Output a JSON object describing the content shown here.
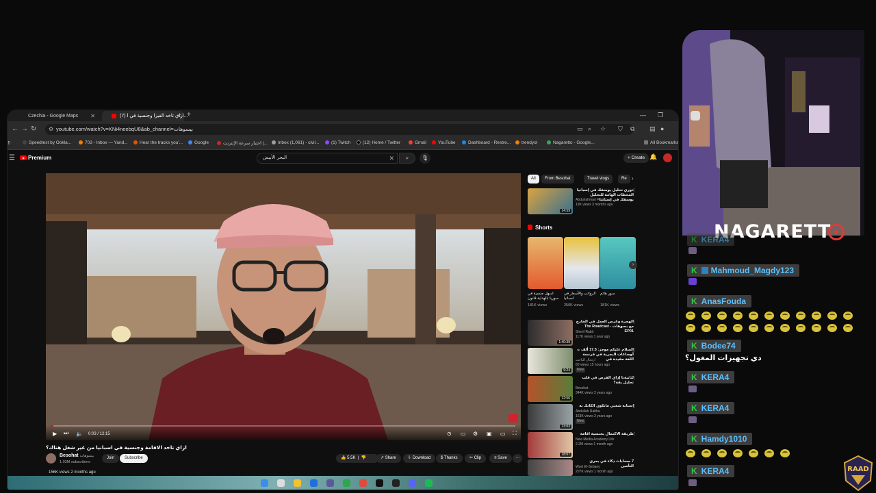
{
  "browser": {
    "tabs": [
      {
        "label": "Czechia - Google Maps",
        "active": false
      },
      {
        "label": "(7) ازاي تاخد الفيزا وجنسية في ا...",
        "active": true
      }
    ],
    "url": "youtube.com/watch?v=KNi4neebqU8&ab_channel=بيسوهات",
    "bookmarks": [
      "Speedtest by Ookla...",
      "703 - Inbox — Yand...",
      "Hear the tracks you'...",
      "Google",
      "اختبار سرعة الإنترنت |...",
      "Inbox (1,061) - civil...",
      "(1) Twitch",
      "(12) Home / Twitter",
      "Gmail",
      "YouTube",
      "Dashboard - Restre...",
      "trendyol",
      "Nagaretto - Google...",
      "All Bookmarks"
    ]
  },
  "youtube": {
    "logo": "Premium",
    "search_value": "البحر الأبيض",
    "create_label": "Create",
    "video": {
      "title": "ازاي تاخد الاقامة وجنسية في اسبانيا من غير شغل هناك؟",
      "time": "0:03 / 12:15",
      "progress": 0.004,
      "channel": "Besohat",
      "channel_ar": "بيسوهات",
      "subscribers": "1.03M subscribers",
      "join": "Join",
      "subscribe": "Subscribe",
      "likes": "5.5K",
      "share": "Share",
      "download": "Download",
      "thanks": "Thanks",
      "clip": "Clip",
      "save": "Save",
      "views_line": "156K views  2 months ago"
    },
    "chips": [
      "All",
      "From Besohat",
      "Travel vlogs",
      "Re"
    ],
    "top_rec": {
      "title": "دوري تحليل يوسفك في إسبانيا المحطات الهامة للتحليل بوسفك في إسبانيا",
      "channel": "Abdulrahman Fawzy",
      "meta": "19K views  3 months ago",
      "duration": "14:59"
    },
    "shorts_label": "Shorts",
    "shorts": [
      {
        "title": "اسهل جنسية في سوريا بالهداية قانون",
        "views": "181K views"
      },
      {
        "title": "الرواتب والأسعار في اسبانيا",
        "views": "250K views"
      },
      {
        "title": "سور هاتم",
        "views": "181K views"
      }
    ],
    "recs": [
      {
        "title": "الهجرة وغرص العمل في الخارج مع بسوهات - The Roadcast EP01",
        "channel": "Sherif Rabit",
        "meta": "117K views  1 year ago",
        "duration": "1:40:39"
      },
      {
        "title": "السلام عليكم موجز: 17.5 ألف ☕ أوضاعات البحرية في فرنسة اللغة مفيدة في",
        "channel": "ارتحال الباحث",
        "meta": "60 views  15 hours ago",
        "badge": "New",
        "duration": "9:24"
      },
      {
        "title": "لثانيةنا إزاي الفرص في قلب تحليل بقة؟",
        "channel": "Besohat",
        "meta": "344K views  2 years ago",
        "duration": "12:56"
      },
      {
        "title": "|سنانه شعبي مانكون الكانك ته",
        "channel": "Abdullah Rabha",
        "meta": "163K views  3 years ago",
        "badge": "New",
        "duration": "13:03"
      },
      {
        "title": "طريقة الاكتمال بجنسية اقامة",
        "channel": "New Media Academy Life",
        "meta": "2.2M views  1 month ago",
        "duration": "18:07"
      },
      {
        "title": "7 حسابات ذكاء في بمري التأمين",
        "channel": "Wael El-Sebaey",
        "meta": "207K views  1 month ago",
        "duration": ""
      }
    ]
  },
  "stream": {
    "streamer": "NAGARETT",
    "chat": [
      {
        "user": "KERA4",
        "emotes": 0,
        "message": ""
      },
      {
        "user": "Mahmoud_Magdy123",
        "emotes": 0,
        "message": ""
      },
      {
        "user": "AnasFouda",
        "emotes": 22,
        "message": ""
      },
      {
        "user": "Bodee74",
        "emotes": 0,
        "message": "دي تجهيزات المغول؟"
      },
      {
        "user": "KERA4",
        "emotes": 0,
        "message": ""
      },
      {
        "user": "KERA4",
        "emotes": 0,
        "message": ""
      },
      {
        "user": "Hamdy1010",
        "emotes": 7,
        "message": ""
      },
      {
        "user": "KERA4",
        "emotes": 0,
        "message": ""
      }
    ],
    "badge_text": "RAAD"
  },
  "colors": {
    "accent_red": "#ff0000",
    "chat_name": "#5bc0ff",
    "chat_badge": "#2ecc40"
  }
}
